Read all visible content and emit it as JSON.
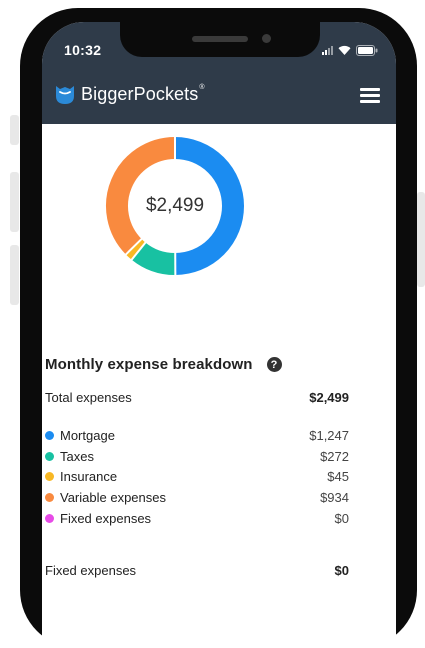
{
  "status_bar": {
    "time": "10:32"
  },
  "header": {
    "brand": "BiggerPockets",
    "brand_mark": "®"
  },
  "donut": {
    "total_label": "$2,499",
    "segments": [
      {
        "name": "Mortgage",
        "value": 1247,
        "color": "#1b8cf1"
      },
      {
        "name": "Taxes",
        "value": 272,
        "color": "#18c1a2"
      },
      {
        "name": "Insurance",
        "value": 45,
        "color": "#f8b825"
      },
      {
        "name": "Variable expenses",
        "value": 934,
        "color": "#f98a3f"
      },
      {
        "name": "Fixed expenses",
        "value": 0,
        "color": "#e74be7"
      }
    ],
    "total_value": 2499
  },
  "breakdown": {
    "title": "Monthly expense breakdown",
    "help_symbol": "?",
    "total_label": "Total expenses",
    "total_value": "$2,499",
    "items": [
      {
        "label": "Mortgage",
        "value": "$1,247",
        "color": "#1b8cf1"
      },
      {
        "label": "Taxes",
        "value": "$272",
        "color": "#18c1a2"
      },
      {
        "label": "Insurance",
        "value": "$45",
        "color": "#f8b825"
      },
      {
        "label": "Variable expenses",
        "value": "$934",
        "color": "#f98a3f"
      },
      {
        "label": "Fixed expenses",
        "value": "$0",
        "color": "#e74be7"
      }
    ],
    "fixed_label": "Fixed expenses",
    "fixed_value": "$0"
  },
  "colors": {
    "header_bg": "#2f3b49",
    "logo_blue": "#2b8ad8"
  }
}
